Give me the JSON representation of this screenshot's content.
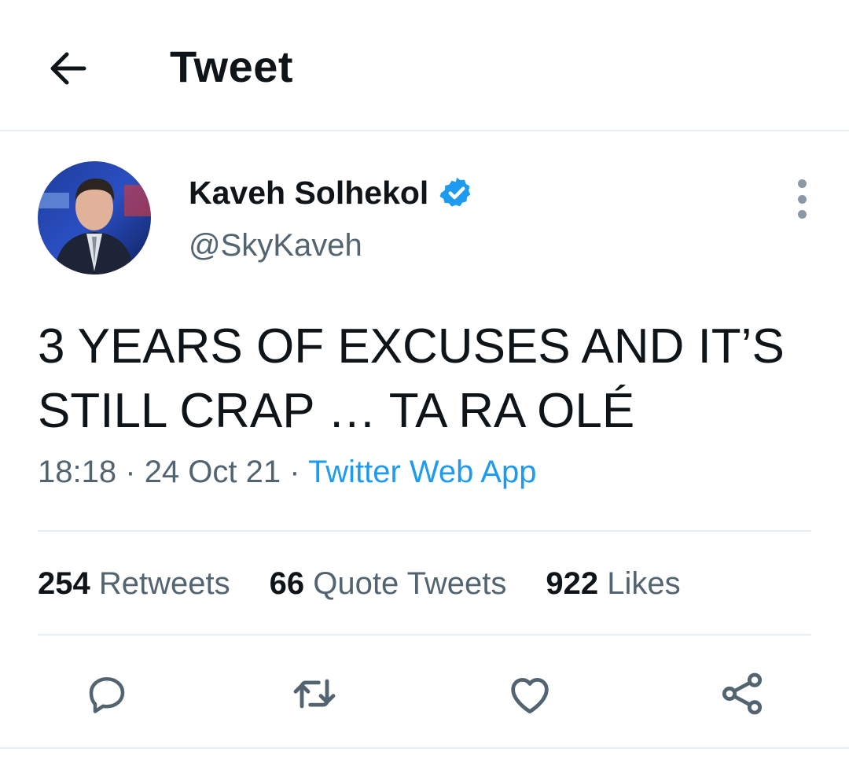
{
  "header": {
    "title": "Tweet",
    "back_icon": "arrow-left-icon"
  },
  "author": {
    "name": "Kaveh Solhekol",
    "handle": "@SkyKaveh",
    "verified": true,
    "verified_color": "#1d9bf0"
  },
  "tweet": {
    "line1": "3 YEARS OF EXCUSES AND IT’S",
    "line2": "STILL CRAP … TA RA OLÉ",
    "time": "18:18",
    "separator": "·",
    "date": "24 Oct 21",
    "source": "Twitter Web App"
  },
  "stats": {
    "retweets_count": "254",
    "retweets_label": "Retweets",
    "quotes_count": "66",
    "quotes_label": "Quote Tweets",
    "likes_count": "922",
    "likes_label": "Likes"
  },
  "actions": {
    "reply_icon": "reply-icon",
    "retweet_icon": "retweet-icon",
    "like_icon": "heart-icon",
    "share_icon": "share-icon"
  },
  "colors": {
    "text_primary": "#0f1419",
    "text_secondary": "#536471",
    "accent": "#1d9bf0",
    "divider": "#e6ecf0"
  }
}
